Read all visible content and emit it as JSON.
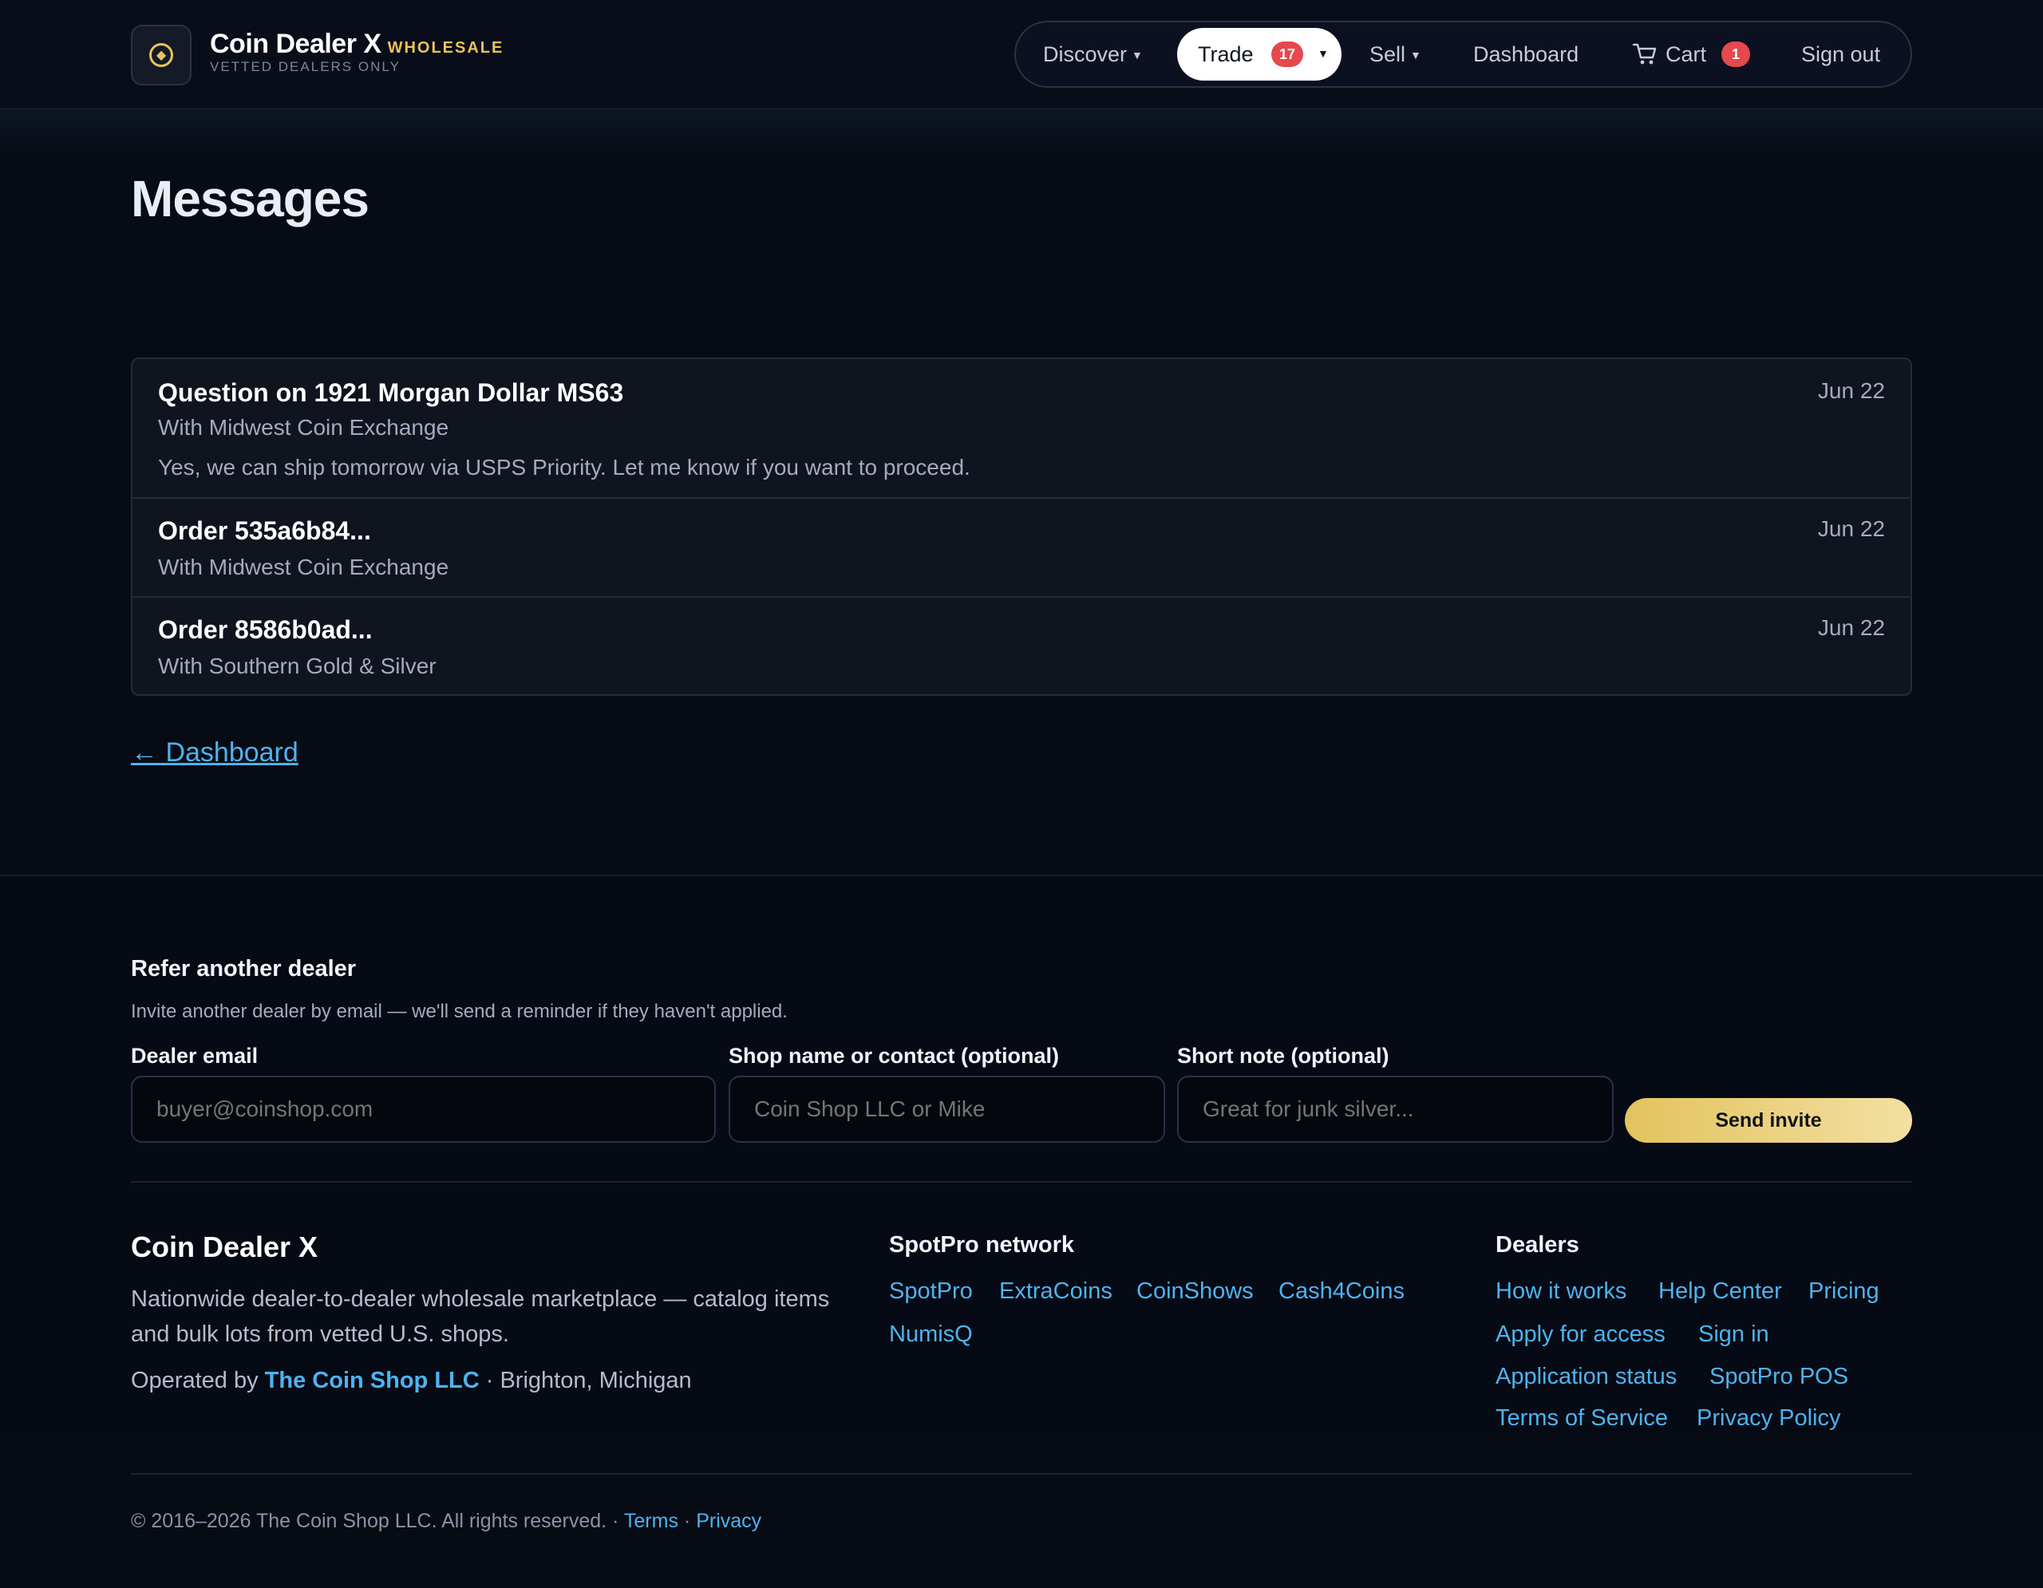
{
  "brand": {
    "name": "Coin Dealer X",
    "tag": "WHOLESALE",
    "sub": "VETTED DEALERS ONLY"
  },
  "nav": {
    "discover": "Discover",
    "trade": "Trade",
    "trade_badge": "17",
    "sell": "Sell",
    "dashboard": "Dashboard",
    "cart": "Cart",
    "cart_badge": "1",
    "signout": "Sign out"
  },
  "page": {
    "title": "Messages",
    "back_link": "← Dashboard"
  },
  "messages": [
    {
      "title": "Question on 1921 Morgan Dollar MS63",
      "with": "With Midwest Coin Exchange",
      "preview": "Yes, we can ship tomorrow via USPS Priority. Let me know if you want to proceed.",
      "date": "Jun 22"
    },
    {
      "title": "Order 535a6b84...",
      "with": "With Midwest Coin Exchange",
      "date": "Jun 22"
    },
    {
      "title": "Order 8586b0ad...",
      "with": "With Southern Gold & Silver",
      "date": "Jun 22"
    }
  ],
  "referral": {
    "title": "Refer another dealer",
    "subtitle": "Invite another dealer by email — we'll send a reminder if they haven't applied.",
    "email_label": "Dealer email",
    "email_placeholder": "buyer@coinshop.com",
    "shop_label": "Shop name or contact (optional)",
    "shop_placeholder": "Coin Shop LLC or Mike",
    "note_label": "Short note (optional)",
    "note_placeholder": "Great for junk silver...",
    "send": "Send invite"
  },
  "footer": {
    "brand": "Coin Dealer X",
    "description": "Nationwide dealer-to-dealer wholesale marketplace — catalog items and bulk lots from vetted U.S. shops.",
    "operated_prefix": "Operated by",
    "operator": "The Coin Shop LLC",
    "operated_suffix": "· Brighton, Michigan",
    "network_title": "SpotPro network",
    "network": [
      "SpotPro",
      "ExtraCoins",
      "CoinShows",
      "Cash4Coins",
      "NumisQ"
    ],
    "dealers_title": "Dealers",
    "dealers": [
      "How it works",
      "Help Center",
      "Pricing",
      "Apply for access",
      "Sign in",
      "Application status",
      "SpotPro POS",
      "Terms of Service",
      "Privacy Policy"
    ],
    "copyright": "© 2016–2026 The Coin Shop LLC. All rights reserved. ·",
    "terms": "Terms",
    "privacy": "Privacy"
  },
  "colors": {
    "accent_gold": "#e9c25c",
    "link_blue": "#4db3f0",
    "badge_red": "#e5484d",
    "background": "#070b14"
  },
  "icons": {
    "logo": "coin-logo-icon",
    "cart": "cart-icon",
    "caret": "chevron-down-icon"
  }
}
